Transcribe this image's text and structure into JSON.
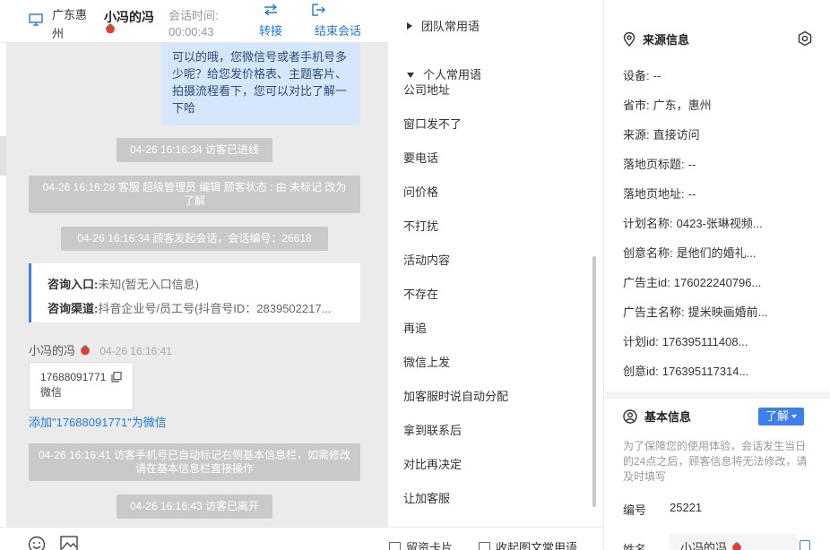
{
  "header": {
    "region": "广东惠州",
    "visitor_name": "小冯的冯",
    "session_time_label": "会话时间:",
    "session_time": "00:00:43",
    "transfer_label": "转接",
    "end_label": "结束会话",
    "accent_color": "#1f7ae0"
  },
  "chat": {
    "agent_bubble": "可以的哦，您微信号或者手机号多少呢？给您发价格表、主题客片、拍摄流程看下，您可以对比了解一下哈",
    "system_1": "04-26 16:16:34 访客已进线",
    "system_2": "04-26 16:16:28 客服 超级管理员 编辑 顾客状态 : 由 未标记 改为 了解",
    "system_3": "04-26 16:16:34 顾客发起会话，会话编号：26618",
    "entry_label": "咨询入口:",
    "entry_value": "未知(暂无入口信息)",
    "channel_label": "咨询渠道:",
    "channel_value": "抖音企业号/员工号(抖音号ID：2839502217...",
    "visitor_name": "小冯的冯",
    "visitor_time": "04-26 16:16:41",
    "phone_number": "17688091771",
    "phone_type": "微信",
    "add_link": "添加\"17688091771\"为微信",
    "system_4": "04-26 16:16:41 访客手机号已自动标记右侧基本信息栏，如需修改请在基本信息栏直接操作",
    "system_5": "04-26 16:16:43 访客已离开"
  },
  "phrases": {
    "team_group": "团队常用语",
    "personal_group": "个人常用语",
    "items": [
      "公司地址",
      "窗口发不了",
      "要电话",
      "问价格",
      "不打扰",
      "活动内容",
      "不存在",
      "再追",
      "微信上发",
      "加客服时说自动分配",
      "拿到联系后",
      "对比再决定",
      "让加客服"
    ],
    "footer_card": "留资卡片",
    "footer_common": "收起图文常用语"
  },
  "info": {
    "source_title": "来源信息",
    "fields": [
      {
        "label": "设备:",
        "value": "--"
      },
      {
        "label": "省市:",
        "value": "广东，惠州"
      },
      {
        "label": "来源:",
        "value": "直接访问"
      },
      {
        "label": "落地页标题:",
        "value": "--"
      },
      {
        "label": "落地页地址:",
        "value": "--"
      },
      {
        "label": "计划名称:",
        "value": "0423-张琳视频..."
      },
      {
        "label": "创意名称:",
        "value": "是他们的婚礼..."
      },
      {
        "label": "广告主id:",
        "value": "176022240796..."
      },
      {
        "label": "广告主名称:",
        "value": "提米映画婚前..."
      },
      {
        "label": "计划id:",
        "value": "176395111408..."
      },
      {
        "label": "创意id:",
        "value": "176395117314..."
      }
    ],
    "basic_title": "基本信息",
    "status_button": "了解",
    "notice": "为了保障您的使用体验，会话发生当日的24点之后，顾客信息将无法修改，请及时填写",
    "id_label": "编号",
    "id_value": "25221",
    "name_label": "姓名",
    "name_value": "小冯的冯"
  }
}
